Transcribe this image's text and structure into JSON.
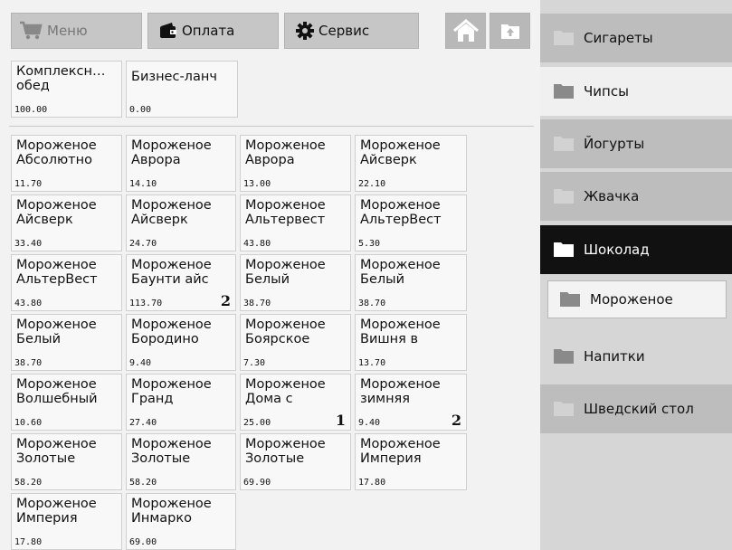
{
  "toolbar": {
    "menu_label": "Меню",
    "menu_icon": "cart-icon",
    "pay_label": "Оплата",
    "pay_icon": "wallet-icon",
    "service_label": "Сервис",
    "service_icon": "gear-icon",
    "home_icon": "home-icon",
    "up_icon": "folder-up-icon"
  },
  "combos": [
    {
      "line1": "Комплексн…",
      "line2": "обед",
      "price": "100.00"
    },
    {
      "line1": "",
      "line2": "Бизнес-ланч",
      "price": "0.00"
    }
  ],
  "products": [
    {
      "line1": "Мороженое",
      "line2": "Абсолютно",
      "price": "11.70",
      "qty": ""
    },
    {
      "line1": "Мороженое",
      "line2": "Аврора",
      "price": "14.10",
      "qty": ""
    },
    {
      "line1": "Мороженое",
      "line2": "Аврора",
      "price": "13.00",
      "qty": ""
    },
    {
      "line1": "Мороженое",
      "line2": "Айсверк",
      "price": "22.10",
      "qty": ""
    },
    {
      "line1": "Мороженое",
      "line2": "Айсверк",
      "price": "33.40",
      "qty": ""
    },
    {
      "line1": "Мороженое",
      "line2": "Айсверк",
      "price": "24.70",
      "qty": ""
    },
    {
      "line1": "Мороженое",
      "line2": "Альтервест",
      "price": "43.80",
      "qty": ""
    },
    {
      "line1": "Мороженое",
      "line2": "АльтерВест",
      "price": "5.30",
      "qty": ""
    },
    {
      "line1": "Мороженое",
      "line2": "АльтерВест",
      "price": "43.80",
      "qty": ""
    },
    {
      "line1": "Мороженое",
      "line2": "Баунти айс",
      "price": "113.70",
      "qty": "2"
    },
    {
      "line1": "Мороженое",
      "line2": "Белый",
      "price": "38.70",
      "qty": ""
    },
    {
      "line1": "Мороженое",
      "line2": "Белый",
      "price": "38.70",
      "qty": ""
    },
    {
      "line1": "Мороженое",
      "line2": "Белый",
      "price": "38.70",
      "qty": ""
    },
    {
      "line1": "Мороженое",
      "line2": "Бородино",
      "price": "9.40",
      "qty": ""
    },
    {
      "line1": "Мороженое",
      "line2": "Боярское",
      "price": "7.30",
      "qty": ""
    },
    {
      "line1": "Мороженое",
      "line2": "Вишня в",
      "price": "13.70",
      "qty": ""
    },
    {
      "line1": "Мороженое",
      "line2": "Волшебный",
      "price": "10.60",
      "qty": ""
    },
    {
      "line1": "Мороженое",
      "line2": "Гранд",
      "price": "27.40",
      "qty": ""
    },
    {
      "line1": "Мороженое",
      "line2": "Дома с",
      "price": "25.00",
      "qty": "1"
    },
    {
      "line1": "Мороженое",
      "line2": "зимняя",
      "price": "9.40",
      "qty": "2"
    },
    {
      "line1": "Мороженое",
      "line2": "Золотые",
      "price": "58.20",
      "qty": ""
    },
    {
      "line1": "Мороженое",
      "line2": "Золотые",
      "price": "58.20",
      "qty": ""
    },
    {
      "line1": "Мороженое",
      "line2": "Золотые",
      "price": "69.90",
      "qty": ""
    },
    {
      "line1": "Мороженое",
      "line2": "Империя",
      "price": "17.80",
      "qty": ""
    },
    {
      "line1": "Мороженое",
      "line2": "Империя",
      "price": "17.80",
      "qty": ""
    },
    {
      "line1": "Мороженое",
      "line2": "Инмарко",
      "price": "69.00",
      "qty": ""
    }
  ],
  "categories": [
    {
      "label": "Сигареты",
      "style": "gray",
      "icon": "folder-icon"
    },
    {
      "label": "Чипсы",
      "style": "light",
      "icon": "folder-icon"
    },
    {
      "label": "Йогурты",
      "style": "gray",
      "icon": "folder-icon"
    },
    {
      "label": "Жвачка",
      "style": "gray",
      "icon": "folder-icon"
    },
    {
      "label": "Шоколад",
      "style": "dark",
      "icon": "folder-icon"
    },
    {
      "label": "Мороженое",
      "style": "sub",
      "icon": "folder-icon"
    },
    {
      "label": "Напитки",
      "style": "plain",
      "icon": "folder-icon"
    },
    {
      "label": "Шведский стол",
      "style": "gray",
      "icon": "folder-icon"
    }
  ],
  "colors": {
    "selected_category": "#111111",
    "sidebar_bg": "#d6d6d6",
    "button_bg": "#c6c6c6"
  }
}
